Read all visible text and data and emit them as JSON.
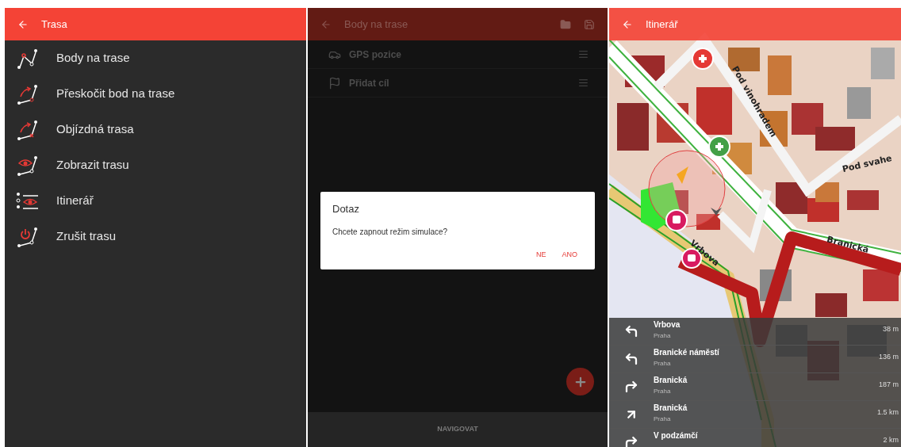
{
  "route_menu": {
    "title": "Trasa",
    "items": [
      {
        "label": "Body na trase",
        "kind": "points"
      },
      {
        "label": "Přeskočit bod na trase",
        "kind": "skip"
      },
      {
        "label": "Objízdná trasa",
        "kind": "detour"
      },
      {
        "label": "Zobrazit trasu",
        "kind": "show"
      },
      {
        "label": "Itinerář",
        "kind": "itinerary"
      },
      {
        "label": "Zrušit trasu",
        "kind": "cancel"
      }
    ]
  },
  "waypoints": {
    "title": "Body na trase",
    "rows": [
      {
        "label": "GPS pozice",
        "kind": "car"
      },
      {
        "label": "Přidat cíl",
        "kind": "flag"
      }
    ],
    "dialog": {
      "title": "Dotaz",
      "message": "Chcete zapnout režim simulace?",
      "buttons": [
        "NE",
        "ANO"
      ]
    },
    "bottom_button": "NAVIGOVAT"
  },
  "itinerary": {
    "title": "Itinerář",
    "map_labels": [
      "Pod vinohradem",
      "Pod svahe",
      "Branická",
      "Vrbova"
    ],
    "steps": [
      {
        "street": "Vrbova",
        "city": "Praha",
        "distance": "38 m",
        "kind": "left"
      },
      {
        "street": "Branické náměstí",
        "city": "Praha",
        "distance": "136 m",
        "kind": "left"
      },
      {
        "street": "Branická",
        "city": "Praha",
        "distance": "187 m",
        "kind": "right"
      },
      {
        "street": "Branická",
        "city": "Praha",
        "distance": "1.5 km",
        "kind": "slight-right"
      },
      {
        "street": "V podzámčí",
        "distance": "2 km",
        "kind": "right"
      }
    ]
  }
}
